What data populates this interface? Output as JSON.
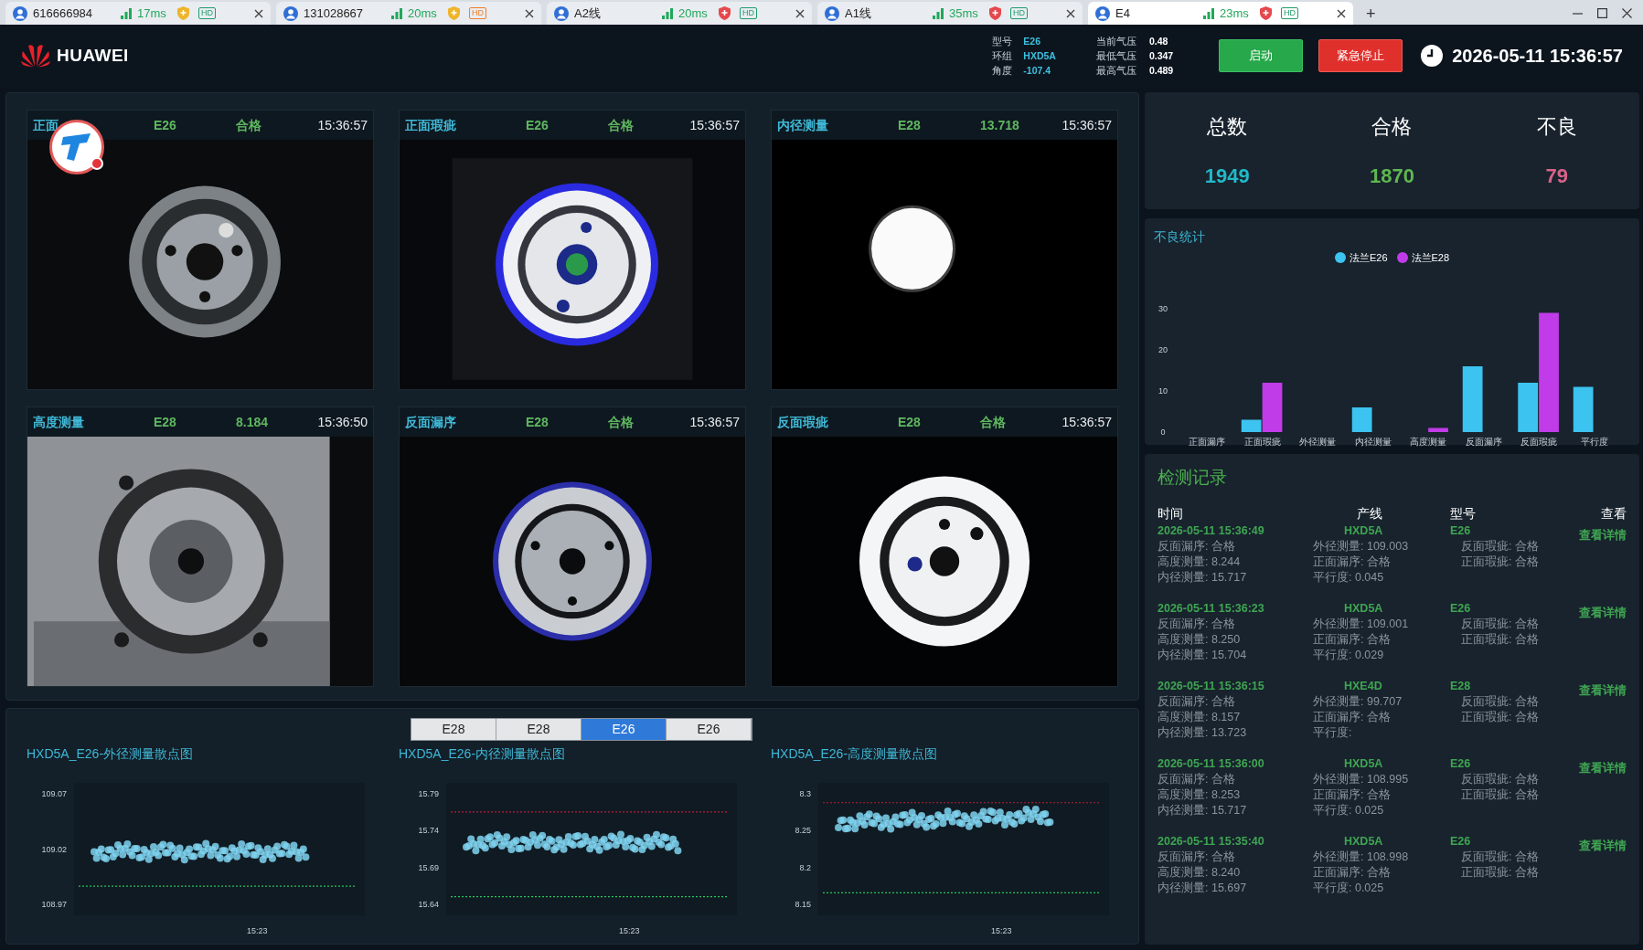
{
  "browser_tabs": [
    {
      "label": "616666984",
      "ping": "17ms",
      "shield": {
        "color": "#f0b429"
      },
      "hd_badge": {
        "label": "HD",
        "color": "#1f9d6a"
      },
      "selected": false
    },
    {
      "label": "131028667",
      "ping": "20ms",
      "shield": {
        "color": "#f0b429"
      },
      "hd_badge": {
        "label": "HD",
        "color": "#ef7d2a"
      },
      "selected": false
    },
    {
      "label": "A2线",
      "ping": "20ms",
      "shield": {
        "color": "#e5484d"
      },
      "hd_badge": {
        "label": "HD",
        "color": "#1f9d6a"
      },
      "selected": false
    },
    {
      "label": "A1线",
      "ping": "35ms",
      "shield": {
        "color": "#e5484d"
      },
      "hd_badge": {
        "label": "HD",
        "color": "#1f9d6a"
      },
      "selected": false
    },
    {
      "label": "E4",
      "ping": "23ms",
      "shield": {
        "color": "#e5484d"
      },
      "hd_badge": {
        "label": "HD",
        "color": "#1f9d6a"
      },
      "selected": true
    }
  ],
  "new_tab": "+",
  "header": {
    "brand": "HUAWEI",
    "info": [
      {
        "label": "型号",
        "value": "E26"
      },
      {
        "label": "环组",
        "value": "HXD5A"
      },
      {
        "label": "角度",
        "value": "-107.4"
      }
    ],
    "pressure": [
      {
        "label": "当前气压",
        "value": "0.48"
      },
      {
        "label": "最低气压",
        "value": "0.347"
      },
      {
        "label": "最高气压",
        "value": "0.489"
      }
    ],
    "buttons": [
      {
        "label": "启动",
        "kind": "start"
      },
      {
        "label": "紧急停止",
        "kind": "stop"
      }
    ],
    "datetime": "2026-05-11 15:36:57"
  },
  "cameras": [
    {
      "title": "正面",
      "model": "E26",
      "result": "合格",
      "time": "15:36:57"
    },
    {
      "title": "正面瑕疵",
      "model": "E26",
      "result": "合格",
      "time": "15:36:57"
    },
    {
      "title": "内径测量",
      "model": "E28",
      "result": "13.718",
      "time": "15:36:57"
    },
    {
      "title": "高度测量",
      "model": "E28",
      "result": "8.184",
      "time": "15:36:50"
    },
    {
      "title": "反面漏序",
      "model": "E28",
      "result": "合格",
      "time": "15:36:57"
    },
    {
      "title": "反面瑕疵",
      "model": "E28",
      "result": "合格",
      "time": "15:36:57"
    }
  ],
  "model_switch": [
    {
      "label": "E28",
      "selected": false
    },
    {
      "label": "E28",
      "selected": false
    },
    {
      "label": "E26",
      "selected": true
    },
    {
      "label": "E26",
      "selected": false
    }
  ],
  "scatter_charts": [
    {
      "title": "HXD5A_E26-外径测量散点图",
      "y_labels": [
        "109.07",
        "109.02",
        "108.97"
      ],
      "x_label": "15:23"
    },
    {
      "title": "HXD5A_E26-内径测量散点图",
      "y_labels": [
        "15.79",
        "15.74",
        "15.69",
        "15.64"
      ],
      "x_label": "15:23"
    },
    {
      "title": "HXD5A_E26-高度测量散点图",
      "y_labels": [
        "8.3",
        "8.25",
        "8.2",
        "8.15"
      ],
      "x_label": "15:23"
    }
  ],
  "stats": [
    {
      "label": "总数",
      "value": "1949",
      "kind": "total"
    },
    {
      "label": "合格",
      "value": "1870",
      "kind": "pass"
    },
    {
      "label": "不良",
      "value": "79",
      "kind": "fail"
    }
  ],
  "defect_stats": {
    "title": "不良统计",
    "chart_data": {
      "type": "bar",
      "categories": [
        "正面漏序",
        "正面瑕疵",
        "外径测量",
        "内径测量",
        "高度测量",
        "反面漏序",
        "反面瑕疵",
        "平行度"
      ],
      "yticks": [
        0,
        10,
        20,
        30
      ],
      "ylim": [
        0,
        30
      ],
      "legend": "top",
      "series": [
        {
          "name": "法兰E26",
          "color": "#3cc3f0",
          "values": [
            0,
            3,
            0,
            6,
            0,
            16,
            12,
            11
          ]
        },
        {
          "name": "法兰E28",
          "color": "#c03ce8",
          "values": [
            0,
            12,
            0,
            0,
            1,
            0,
            29,
            0
          ]
        }
      ]
    }
  },
  "records": {
    "title": "检测记录",
    "columns": [
      "时间",
      "产线",
      "型号",
      "查看"
    ],
    "rows": [
      {
        "time": "2026-05-11 15:36:49",
        "line": "HXD5A",
        "model": "E26",
        "action": "查看详情",
        "left": [
          "反面漏序: 合格",
          "高度测量: 8.244",
          "内径测量: 15.717"
        ],
        "middle": [
          "外径测量: 109.003",
          "正面漏序: 合格",
          "平行度: 0.045"
        ],
        "right": [
          "反面瑕疵: 合格",
          "正面瑕疵: 合格"
        ]
      },
      {
        "time": "2026-05-11 15:36:23",
        "line": "HXD5A",
        "model": "E26",
        "action": "查看详情",
        "left": [
          "反面漏序: 合格",
          "高度测量: 8.250",
          "内径测量: 15.704"
        ],
        "middle": [
          "外径测量: 109.001",
          "正面漏序: 合格",
          "平行度: 0.029"
        ],
        "right": [
          "反面瑕疵: 合格",
          "正面瑕疵: 合格"
        ]
      },
      {
        "time": "2026-05-11 15:36:15",
        "line": "HXE4D",
        "model": "E28",
        "action": "查看详情",
        "left": [
          "反面漏序: 合格",
          "高度测量: 8.157",
          "内径测量: 13.723"
        ],
        "middle": [
          "外径测量: 99.707",
          "正面漏序: 合格",
          "平行度:"
        ],
        "right": [
          "反面瑕疵: 合格",
          "正面瑕疵: 合格"
        ]
      },
      {
        "time": "2026-05-11 15:36:00",
        "line": "HXD5A",
        "model": "E26",
        "action": "查看详情",
        "left": [
          "反面漏序: 合格",
          "高度测量: 8.253",
          "内径测量: 15.717"
        ],
        "middle": [
          "外径测量: 108.995",
          "正面漏序: 合格",
          "平行度: 0.025"
        ],
        "right": [
          "反面瑕疵: 合格",
          "正面瑕疵: 合格"
        ]
      },
      {
        "time": "2026-05-11 15:35:40",
        "line": "HXD5A",
        "model": "E26",
        "action": "查看详情",
        "left": [
          "反面漏序: 合格",
          "高度测量: 8.240",
          "内径测量: 15.697"
        ],
        "middle": [
          "外径测量: 108.998",
          "正面漏序: 合格",
          "平行度: 0.025"
        ],
        "right": [
          "反面瑕疵: 合格",
          "正面瑕疵: 合格"
        ]
      }
    ]
  }
}
